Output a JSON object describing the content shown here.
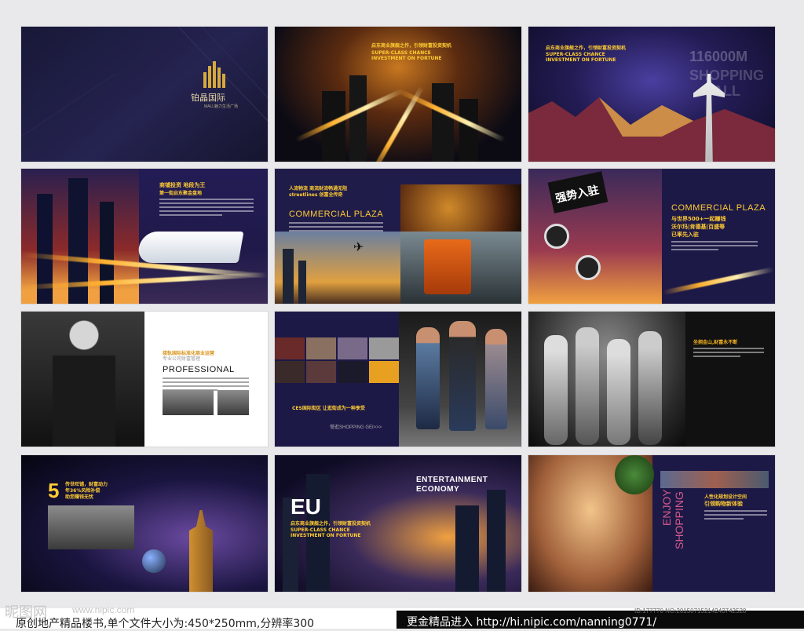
{
  "cards": {
    "c1": {
      "brand_cn": "铂晶国际",
      "brand_sub": "MALL魅力生活广场"
    },
    "c2": {
      "headline": "启东商业旗舰之作，引领财富投资契机",
      "en1": "SUPER-CLASS CHANCE",
      "en2": "INVESTMENT ON FORTUNE"
    },
    "c3": {
      "headline": "启东商业旗舰之作，引领财富投资契机",
      "en1": "SUPER-CLASS CHANCE",
      "en2": "INVESTMENT ON FORTUNE",
      "bg_text1": "116000M",
      "bg_text2": "SHOPPING",
      "bg_text3": "MALL"
    },
    "c4": {
      "title1": "商铺投资 地段为王",
      "title2": "第一街启东聚金盘地"
    },
    "c5": {
      "title1": "人流物流 商流财流畅通无阻",
      "title2": "streetlines 创富全传奇",
      "big": "COMMERCIAL PLAZA"
    },
    "c6": {
      "sign": "强势入驻",
      "big": "COMMERCIAL PLAZA",
      "sub1": "与世界500+一起赚钱",
      "sub2": "沃尔玛|肯德基|百盛等",
      "sub3": "已率先入驻"
    },
    "c7": {
      "title1": "接轨国际标准化商业运营",
      "title2": "专业公司财富管理",
      "big": "PROFESSIONAL"
    },
    "c8": {
      "title": "CES国际街区  让逛街成为一种享受",
      "sub": "慢逛SHOPPING  GEI>>>"
    },
    "c9": {
      "title": "坐拥金山,财富永不断"
    },
    "c10": {
      "num": "5",
      "title1": "传世旺铺，财富动力",
      "title2": "年36%风险补偿",
      "title3": "助您赚钱无忧"
    },
    "c11": {
      "big1": "ENTERTAINMENT",
      "big2": "ECONOMY",
      "eu": "EU",
      "headline": "启东商业旗舰之作，引领财富投资契机",
      "en1": "SUPER-CLASS CHANCE",
      "en2": "INVESTMENT ON FORTUNE"
    },
    "c12": {
      "title1": "人性化规划设计空间",
      "title2": "引领购物新体验",
      "vert1": "ENJOY",
      "vert2": "SHOPPING"
    }
  },
  "footer": {
    "watermark": "昵图网",
    "url": "www.nipic.com",
    "left_text": "原创地产精品楼书,单个文件大小为:450*250mm,分辨率300",
    "right_text": "更金精品进入  http://hi.nipic.com/nanning0771/",
    "id_text": "ID:177770 NO:20150715214243742528"
  }
}
